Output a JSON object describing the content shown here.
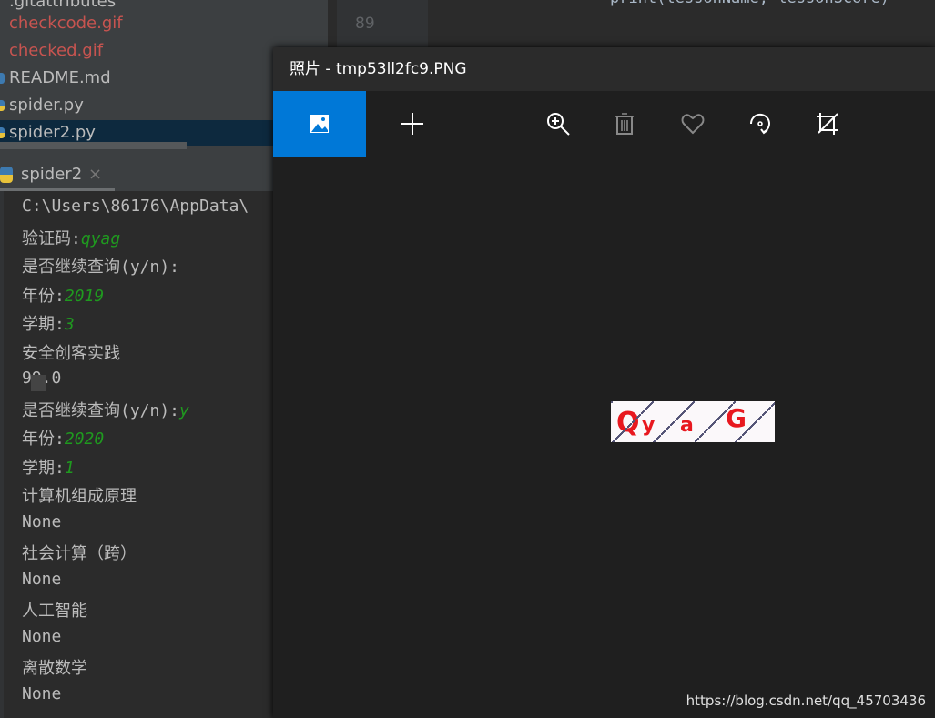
{
  "file_tree": {
    "items": [
      {
        "label": ".gitattributes",
        "status": "normal"
      },
      {
        "label": "checkcode.gif",
        "status": "untracked"
      },
      {
        "label": "checked.gif",
        "status": "untracked"
      },
      {
        "label": "README.md",
        "status": "normal"
      },
      {
        "label": "spider.py",
        "status": "normal"
      },
      {
        "label": "spider2.py",
        "status": "selected"
      }
    ]
  },
  "editor": {
    "line_number": "89",
    "code": "print(lessonName, lessonScore)"
  },
  "run": {
    "tab_label": "spider2",
    "close": "×"
  },
  "console": {
    "lines": [
      {
        "text": "C:\\Users\\86176\\AppData\\",
        "input": ""
      },
      {
        "text": "验证码:",
        "input": "qyag"
      },
      {
        "text": "是否继续查询(y/n):",
        "input": ""
      },
      {
        "text": "年份:",
        "input": "2019"
      },
      {
        "text": "学期:",
        "input": "3"
      },
      {
        "text": "安全创客实践",
        "input": ""
      },
      {
        "text": " 99.0",
        "input": ""
      },
      {
        "text": "是否继续查询(y/n):",
        "input": "y"
      },
      {
        "text": "年份:",
        "input": "2020"
      },
      {
        "text": "学期:",
        "input": "1"
      },
      {
        "text": "计算机组成原理",
        "input": ""
      },
      {
        "text": " None",
        "input": ""
      },
      {
        "text": "社会计算（跨）",
        "input": ""
      },
      {
        "text": " None",
        "input": ""
      },
      {
        "text": "人工智能",
        "input": ""
      },
      {
        "text": " None",
        "input": ""
      },
      {
        "text": "离散数学",
        "input": ""
      },
      {
        "text": " None",
        "input": ""
      }
    ]
  },
  "photos": {
    "title": "照片 - tmp53ll2fc9.PNG",
    "captcha_text": "QyaG",
    "toolbar": [
      "image-icon",
      "plus-icon",
      "zoom-in-icon",
      "trash-icon",
      "heart-icon",
      "rotate-icon",
      "crop-icon"
    ],
    "accent": "#0078d7"
  },
  "watermark": "https://blog.csdn.net/qq_45703436"
}
